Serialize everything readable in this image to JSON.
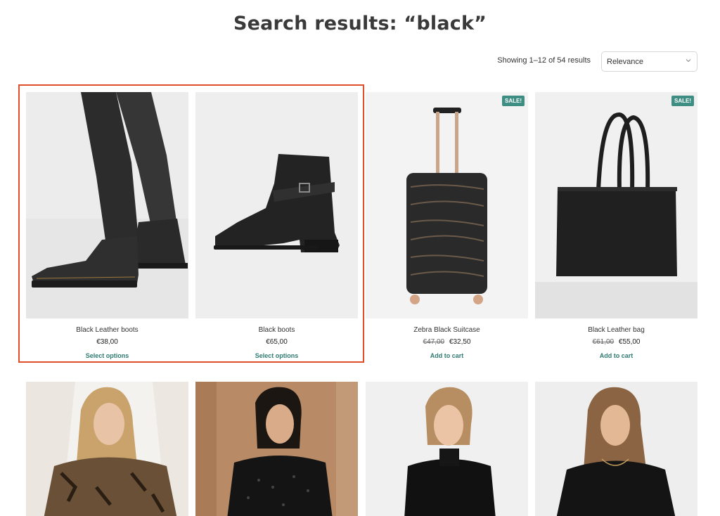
{
  "page": {
    "title": "Search results: “black”"
  },
  "toolbar": {
    "result_count": "Showing 1–12 of 54 results",
    "sort_selected": "Relevance",
    "accent_color": "#2f7a71",
    "highlight_color": "#e04e2a"
  },
  "products": [
    {
      "name": "Black Leather boots",
      "price": "€38,00",
      "old_price": "",
      "action": "Select options",
      "sale_badge": "",
      "image_icon": "leather-boots-image"
    },
    {
      "name": "Black boots",
      "price": "€65,00",
      "old_price": "",
      "action": "Select options",
      "sale_badge": "",
      "image_icon": "ankle-boot-image"
    },
    {
      "name": "Zebra Black Suitcase",
      "price": "€32,50",
      "old_price": "€47,00",
      "action": "Add to cart",
      "sale_badge": "SALE!",
      "image_icon": "suitcase-image"
    },
    {
      "name": "Black Leather bag",
      "price": "€55,00",
      "old_price": "€61,00",
      "action": "Add to cart",
      "sale_badge": "SALE!",
      "image_icon": "handbag-image"
    }
  ],
  "second_row": [
    {
      "image_icon": "lace-top-model-image"
    },
    {
      "image_icon": "polka-dot-top-model-image"
    },
    {
      "image_icon": "sleeveless-top-model-image"
    },
    {
      "image_icon": "black-tee-model-image"
    }
  ]
}
